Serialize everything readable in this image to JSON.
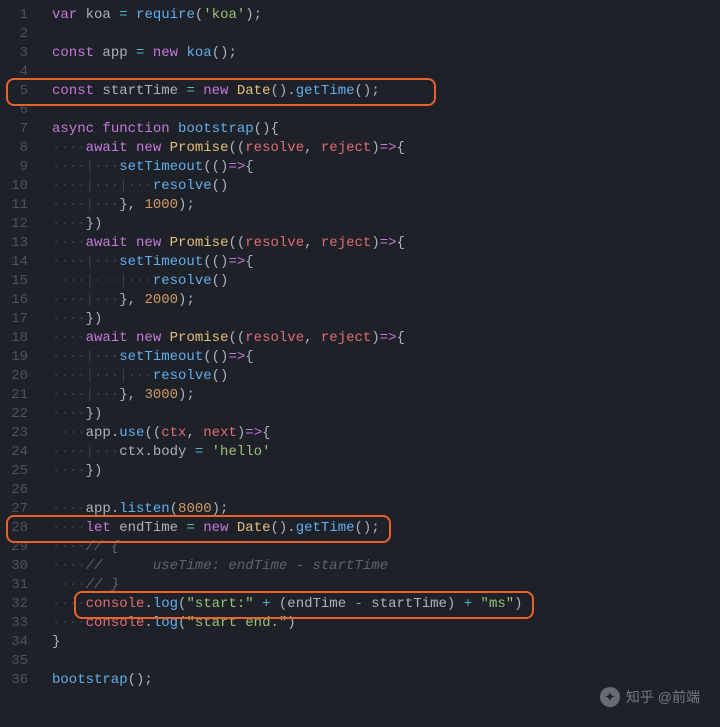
{
  "lineCount": 36,
  "code": {
    "l1": [
      [
        "kw",
        "var"
      ],
      [
        "pn",
        " koa "
      ],
      [
        "op",
        "="
      ],
      [
        "pn",
        " "
      ],
      [
        "fn",
        "require"
      ],
      [
        "pn",
        "("
      ],
      [
        "str",
        "'koa'"
      ],
      [
        "pn",
        ");"
      ]
    ],
    "l2": [],
    "l3": [
      [
        "kw",
        "const"
      ],
      [
        "pn",
        " app "
      ],
      [
        "op",
        "="
      ],
      [
        "pn",
        " "
      ],
      [
        "kw",
        "new"
      ],
      [
        "pn",
        " "
      ],
      [
        "fn",
        "koa"
      ],
      [
        "pn",
        "();"
      ]
    ],
    "l4": [],
    "l5": [
      [
        "kw",
        "const"
      ],
      [
        "pn",
        " startTime "
      ],
      [
        "op",
        "="
      ],
      [
        "pn",
        " "
      ],
      [
        "kw",
        "new"
      ],
      [
        "pn",
        " "
      ],
      [
        "cls",
        "Date"
      ],
      [
        "pn",
        "()."
      ],
      [
        "fn",
        "getTime"
      ],
      [
        "pn",
        "();"
      ]
    ],
    "l6": [],
    "l7": [
      [
        "kw",
        "async"
      ],
      [
        "pn",
        " "
      ],
      [
        "kw",
        "function"
      ],
      [
        "pn",
        " "
      ],
      [
        "fn",
        "bootstrap"
      ],
      [
        "pn",
        "(){"
      ]
    ],
    "l8": [
      [
        "ws",
        "····"
      ],
      [
        "kw",
        "await"
      ],
      [
        "pn",
        " "
      ],
      [
        "kw",
        "new"
      ],
      [
        "pn",
        " "
      ],
      [
        "cls",
        "Promise"
      ],
      [
        "pn",
        "(("
      ],
      [
        "var",
        "resolve"
      ],
      [
        "pn",
        ", "
      ],
      [
        "var",
        "reject"
      ],
      [
        "pn",
        ")"
      ],
      [
        "kw",
        "=>"
      ],
      [
        "pn",
        "{"
      ]
    ],
    "l9": [
      [
        "ws",
        "····|···"
      ],
      [
        "fn",
        "setTimeout"
      ],
      [
        "pn",
        "(()"
      ],
      [
        "kw",
        "=>"
      ],
      [
        "pn",
        "{"
      ]
    ],
    "l10": [
      [
        "ws",
        "····|···|···"
      ],
      [
        "fn",
        "resolve"
      ],
      [
        "pn",
        "()"
      ]
    ],
    "l11": [
      [
        "ws",
        "····|···"
      ],
      [
        "pn",
        "}, "
      ],
      [
        "num",
        "1000"
      ],
      [
        "pn",
        ");"
      ]
    ],
    "l12": [
      [
        "ws",
        "····"
      ],
      [
        "pn",
        "})"
      ]
    ],
    "l13": [
      [
        "ws",
        "····"
      ],
      [
        "kw",
        "await"
      ],
      [
        "pn",
        " "
      ],
      [
        "kw",
        "new"
      ],
      [
        "pn",
        " "
      ],
      [
        "cls",
        "Promise"
      ],
      [
        "pn",
        "(("
      ],
      [
        "var",
        "resolve"
      ],
      [
        "pn",
        ", "
      ],
      [
        "var",
        "reject"
      ],
      [
        "pn",
        ")"
      ],
      [
        "kw",
        "=>"
      ],
      [
        "pn",
        "{"
      ]
    ],
    "l14": [
      [
        "ws",
        "····|···"
      ],
      [
        "fn",
        "setTimeout"
      ],
      [
        "pn",
        "(()"
      ],
      [
        "kw",
        "=>"
      ],
      [
        "pn",
        "{"
      ]
    ],
    "l15": [
      [
        "ws",
        "····|···|···"
      ],
      [
        "fn",
        "resolve"
      ],
      [
        "pn",
        "()"
      ]
    ],
    "l16": [
      [
        "ws",
        "····|···"
      ],
      [
        "pn",
        "}, "
      ],
      [
        "num",
        "2000"
      ],
      [
        "pn",
        ");"
      ]
    ],
    "l17": [
      [
        "ws",
        "····"
      ],
      [
        "pn",
        "})"
      ]
    ],
    "l18": [
      [
        "ws",
        "····"
      ],
      [
        "kw",
        "await"
      ],
      [
        "pn",
        " "
      ],
      [
        "kw",
        "new"
      ],
      [
        "pn",
        " "
      ],
      [
        "cls",
        "Promise"
      ],
      [
        "pn",
        "(("
      ],
      [
        "var",
        "resolve"
      ],
      [
        "pn",
        ", "
      ],
      [
        "var",
        "reject"
      ],
      [
        "pn",
        ")"
      ],
      [
        "kw",
        "=>"
      ],
      [
        "pn",
        "{"
      ]
    ],
    "l19": [
      [
        "ws",
        "····|···"
      ],
      [
        "fn",
        "setTimeout"
      ],
      [
        "pn",
        "(()"
      ],
      [
        "kw",
        "=>"
      ],
      [
        "pn",
        "{"
      ]
    ],
    "l20": [
      [
        "ws",
        "····|···|···"
      ],
      [
        "fn",
        "resolve"
      ],
      [
        "pn",
        "()"
      ]
    ],
    "l21": [
      [
        "ws",
        "····|···"
      ],
      [
        "pn",
        "}, "
      ],
      [
        "num",
        "3000"
      ],
      [
        "pn",
        ");"
      ]
    ],
    "l22": [
      [
        "ws",
        "····"
      ],
      [
        "pn",
        "})"
      ]
    ],
    "l23": [
      [
        "ws",
        "····"
      ],
      [
        "pn",
        "app."
      ],
      [
        "fn",
        "use"
      ],
      [
        "pn",
        "(("
      ],
      [
        "var",
        "ctx"
      ],
      [
        "pn",
        ", "
      ],
      [
        "var",
        "next"
      ],
      [
        "pn",
        ")"
      ],
      [
        "kw",
        "=>"
      ],
      [
        "pn",
        "{"
      ]
    ],
    "l24": [
      [
        "ws",
        "····|···"
      ],
      [
        "pn",
        "ctx.body "
      ],
      [
        "op",
        "="
      ],
      [
        "pn",
        " "
      ],
      [
        "str",
        "'hello'"
      ]
    ],
    "l25": [
      [
        "ws",
        "····"
      ],
      [
        "pn",
        "})"
      ]
    ],
    "l26": [],
    "l27": [
      [
        "ws",
        "····"
      ],
      [
        "pn",
        "app."
      ],
      [
        "fn",
        "listen"
      ],
      [
        "pn",
        "("
      ],
      [
        "num",
        "8000"
      ],
      [
        "pn",
        ");"
      ]
    ],
    "l28": [
      [
        "ws",
        "····"
      ],
      [
        "kw",
        "let"
      ],
      [
        "pn",
        " endTime "
      ],
      [
        "op",
        "="
      ],
      [
        "pn",
        " "
      ],
      [
        "kw",
        "new"
      ],
      [
        "pn",
        " "
      ],
      [
        "cls",
        "Date"
      ],
      [
        "pn",
        "()."
      ],
      [
        "fn",
        "getTime"
      ],
      [
        "pn",
        "();"
      ]
    ],
    "l29": [
      [
        "ws",
        "····"
      ],
      [
        "cm",
        "// {"
      ]
    ],
    "l30": [
      [
        "ws",
        "····"
      ],
      [
        "cm",
        "//      useTime: endTime - startTime"
      ]
    ],
    "l31": [
      [
        "ws",
        "····"
      ],
      [
        "cm",
        "// }"
      ]
    ],
    "l32": [
      [
        "ws",
        "····"
      ],
      [
        "var",
        "console"
      ],
      [
        "pn",
        "."
      ],
      [
        "fn",
        "log"
      ],
      [
        "pn",
        "("
      ],
      [
        "str",
        "\"start:\""
      ],
      [
        "pn",
        " "
      ],
      [
        "op",
        "+"
      ],
      [
        "pn",
        " (endTime "
      ],
      [
        "op",
        "-"
      ],
      [
        "pn",
        " startTime) "
      ],
      [
        "op",
        "+"
      ],
      [
        "pn",
        " "
      ],
      [
        "str",
        "\"ms\""
      ],
      [
        "pn",
        ")"
      ]
    ],
    "l33": [
      [
        "ws",
        "····"
      ],
      [
        "var",
        "console"
      ],
      [
        "pn",
        "."
      ],
      [
        "fn",
        "log"
      ],
      [
        "pn",
        "("
      ],
      [
        "str",
        "\"start end.\""
      ],
      [
        "pn",
        ")"
      ]
    ],
    "l34": [
      [
        "pn",
        "}"
      ]
    ],
    "l35": [],
    "l36": [
      [
        "fn",
        "bootstrap"
      ],
      [
        "pn",
        "();"
      ]
    ]
  },
  "watermark": "知乎 @前端"
}
